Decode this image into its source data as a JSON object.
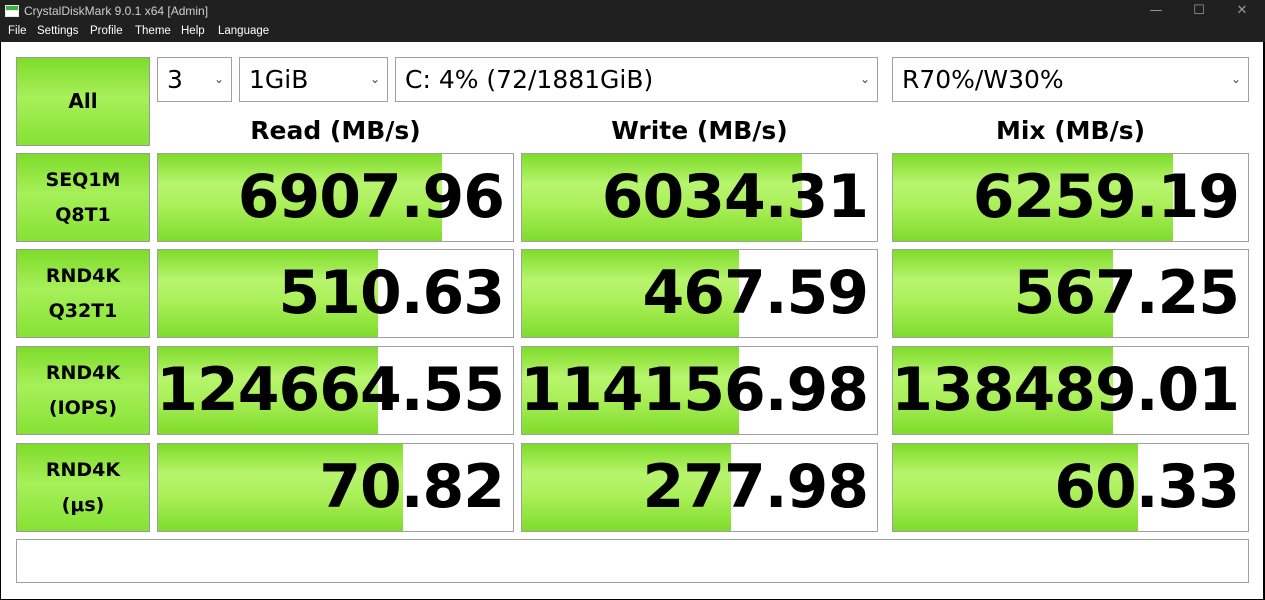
{
  "window": {
    "title": "CrystalDiskMark 9.0.1 x64 [Admin]",
    "controls": {
      "minimize": "—",
      "maximize": "☐",
      "close": "✕"
    }
  },
  "menu": [
    "File",
    "Settings",
    "Profile",
    "Theme",
    "Help",
    "Language"
  ],
  "all_button": "All",
  "count_select": "3",
  "size_select": "1GiB",
  "drive_select": "C: 4% (72/1881GiB)",
  "mix_select": "R70%/W30%",
  "columns": [
    "Read (MB/s)",
    "Write (MB/s)",
    "Mix (MB/s)"
  ],
  "rows": [
    {
      "line1": "SEQ1M",
      "line2": "Q8T1",
      "read": "6907.96",
      "write": "6034.31",
      "mix": "6259.19"
    },
    {
      "line1": "RND4K",
      "line2": "Q32T1",
      "read": "510.63",
      "write": "467.59",
      "mix": "567.25"
    },
    {
      "line1": "RND4K",
      "line2": "(IOPS)",
      "read": "124664.55",
      "write": "114156.98",
      "mix": "138489.01"
    },
    {
      "line1": "RND4K",
      "line2": "(μs)",
      "read": "70.82",
      "write": "277.98",
      "mix": "60.33"
    }
  ],
  "bar_fill_percent": [
    [
      80,
      79,
      79
    ],
    [
      62,
      61,
      62
    ],
    [
      62,
      61,
      62
    ],
    [
      69,
      59,
      69
    ]
  ],
  "status": "",
  "colors": {
    "bar_green": "#8fe33c",
    "title_bg": "#202020"
  }
}
